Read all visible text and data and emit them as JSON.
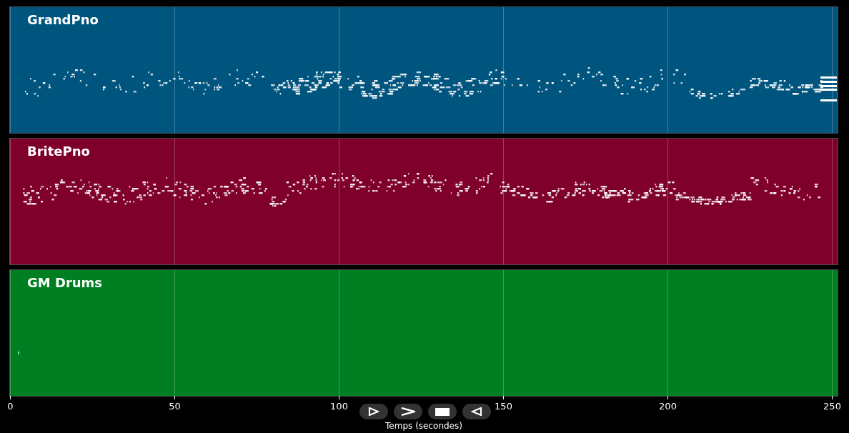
{
  "tracks": [
    {
      "name": "GrandPno",
      "color": "#00557f"
    },
    {
      "name": "BritePno",
      "color": "#7f002a"
    },
    {
      "name": "GM Drums",
      "color": "#007f22"
    }
  ],
  "x_axis": {
    "ticks": [
      "0",
      "50",
      "100",
      "150",
      "200",
      "250"
    ],
    "label": "Temps (secondes)"
  }
}
